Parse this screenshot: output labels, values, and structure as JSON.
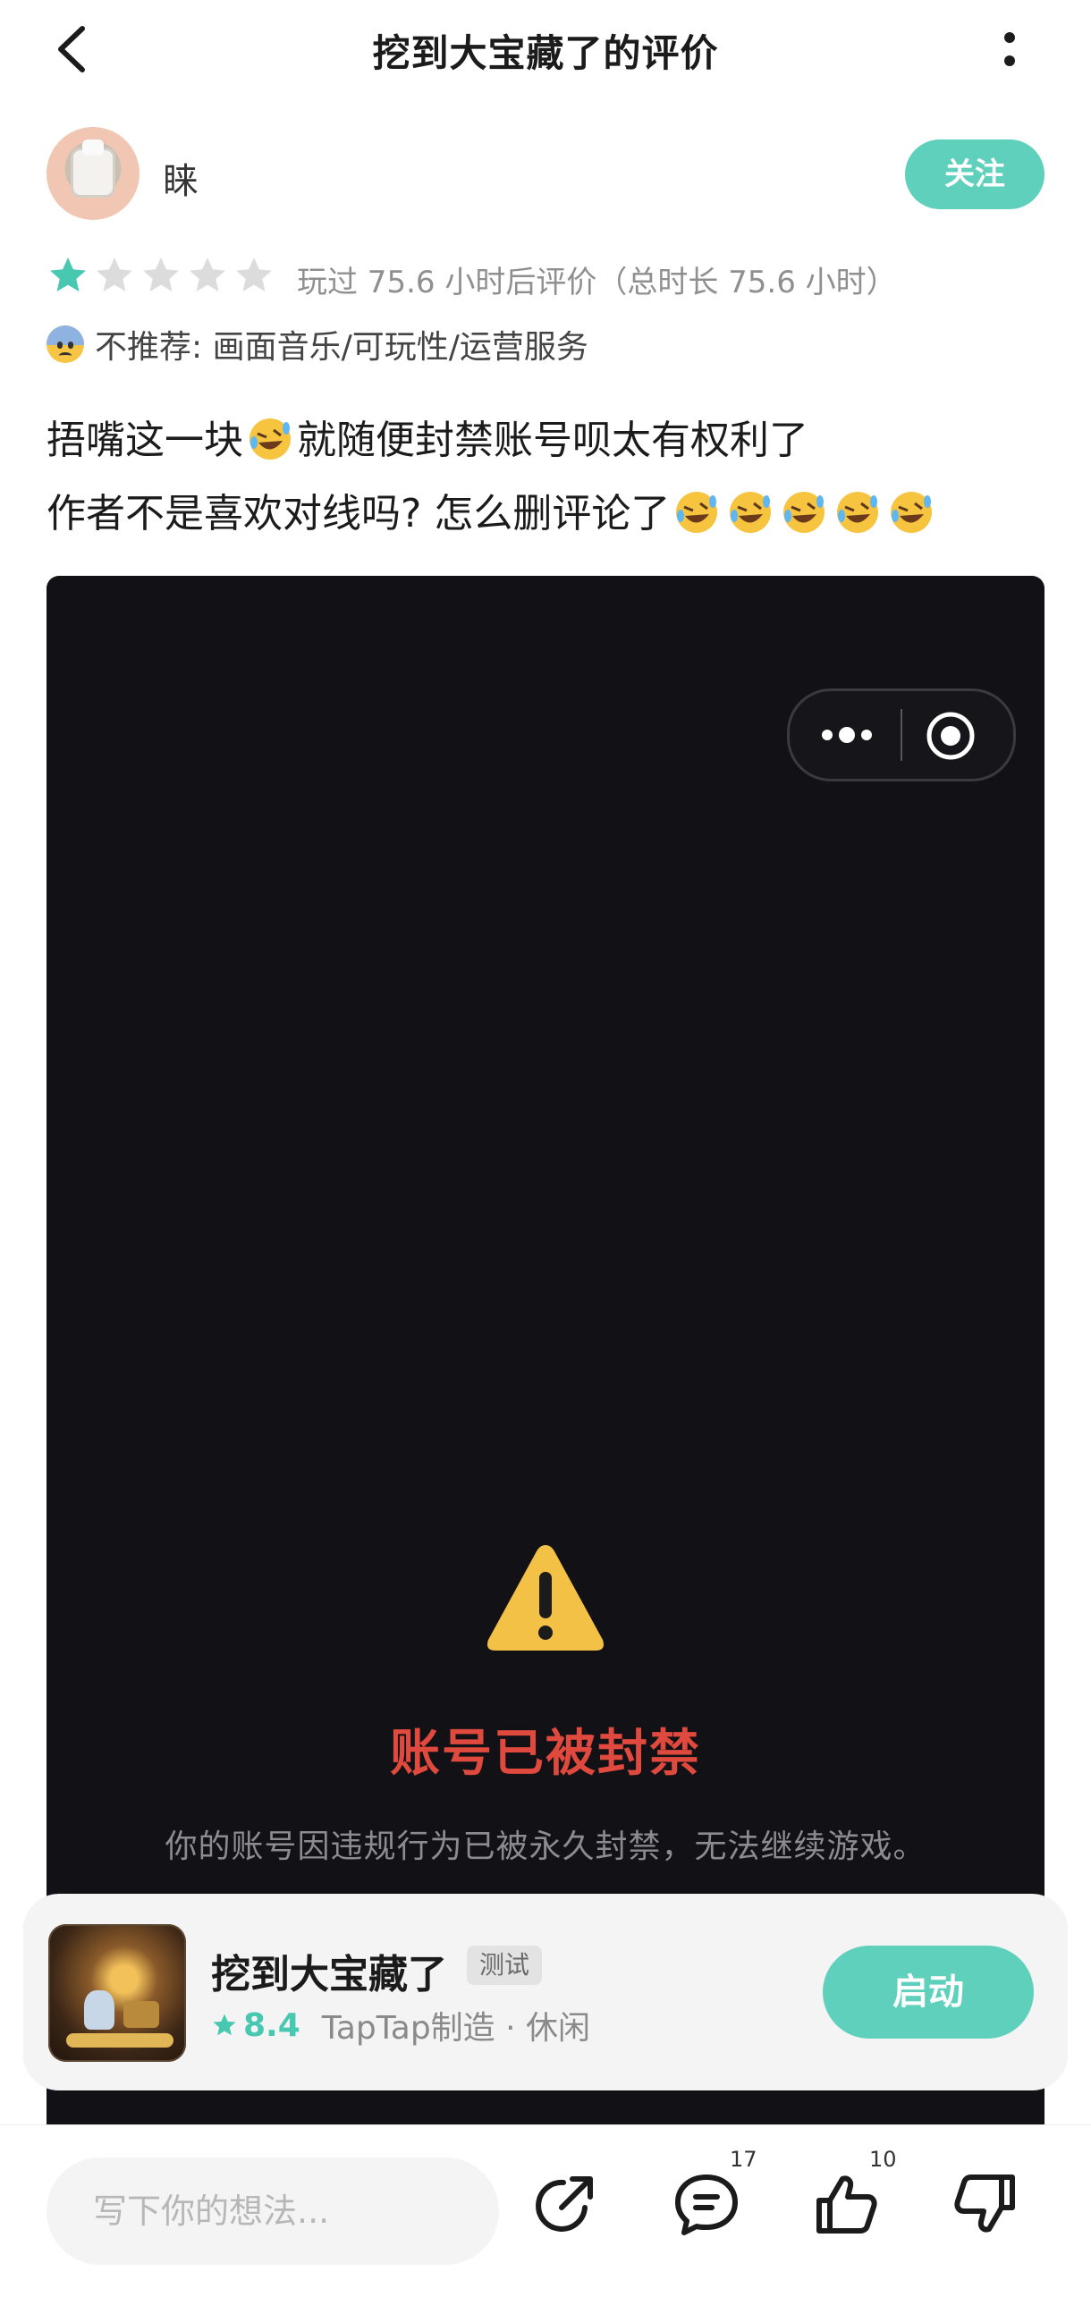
{
  "header": {
    "title": "挖到大宝藏了的评价",
    "back_icon": "chevron-left-icon",
    "more_icon": "vertical-dots-icon"
  },
  "author": {
    "name": "睐",
    "follow_label": "关注"
  },
  "rating": {
    "stars": 1,
    "max_stars": 5,
    "play_info": "玩过 75.6 小时后评价（总时长 75.6 小时）"
  },
  "recommendation": {
    "text": "不推荐: 画面音乐/可玩性/运营服务"
  },
  "review": {
    "line1_a": "捂嘴这一块",
    "line1_b": "就随便封禁账号呗太有权利了",
    "line2": "作者不是喜欢对线吗? 怎么删评论了"
  },
  "screenshot": {
    "ban_title": "账号已被封禁",
    "ban_desc": "你的账号因违规行为已被永久封禁，无法继续游戏。"
  },
  "game": {
    "name": "挖到大宝藏了",
    "badge": "测试",
    "score": "8.4",
    "maker": "TapTap制造 · 休闲",
    "launch_label": "启动"
  },
  "bottom": {
    "input_placeholder": "写下你的想法...",
    "comment_count": "17",
    "like_count": "10"
  },
  "colors": {
    "accent": "#5fd0bb",
    "score": "#48c8b1",
    "ban_red": "#e0493d"
  }
}
